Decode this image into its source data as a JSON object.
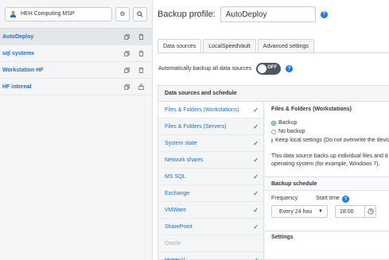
{
  "sidebar": {
    "company_name": "HEH Computing MSP",
    "profiles": [
      {
        "label": "AutoDeploy",
        "active": true
      },
      {
        "label": "sql systems",
        "active": false
      },
      {
        "label": "Workstation HF",
        "active": false
      },
      {
        "label": "HF internal",
        "active": false
      }
    ]
  },
  "header": {
    "title": "Backup profile:",
    "profile_name": "AutoDeploy"
  },
  "tabs": [
    {
      "label": "Data sources",
      "active": true
    },
    {
      "label": "LocalSpeedVault",
      "active": false
    },
    {
      "label": "Advanced settings",
      "active": false
    }
  ],
  "auto_backup": {
    "label": "Automatically backup all data sources",
    "toggle_text": "OFF"
  },
  "panel": {
    "title": "Data sources and schedule",
    "data_sources": [
      {
        "label": "Files & Folders (Workstations)",
        "checked": true,
        "disabled": false,
        "active": true
      },
      {
        "label": "Files & Folders (Servers)",
        "checked": true,
        "disabled": false,
        "active": false
      },
      {
        "label": "System state",
        "checked": true,
        "disabled": false,
        "active": false
      },
      {
        "label": "Network shares",
        "checked": true,
        "disabled": false,
        "active": false
      },
      {
        "label": "MS SQL",
        "checked": true,
        "disabled": false,
        "active": false
      },
      {
        "label": "Exchange",
        "checked": true,
        "disabled": false,
        "active": false
      },
      {
        "label": "VMWare",
        "checked": true,
        "disabled": false,
        "active": false
      },
      {
        "label": "SharePoint",
        "checked": true,
        "disabled": false,
        "active": false
      },
      {
        "label": "Oracle",
        "checked": false,
        "disabled": true,
        "active": false
      },
      {
        "label": "Hyper-V",
        "checked": true,
        "disabled": false,
        "active": false
      }
    ]
  },
  "detail": {
    "title": "Files & Folders (Workstations)",
    "options": [
      {
        "label": "Backup",
        "selected": true
      },
      {
        "label": "No backup",
        "selected": false
      },
      {
        "label": "Keep local settings (Do not overwrite the devic",
        "selected": false
      }
    ],
    "description_line1": "This data source backs up individual files and d",
    "description_line2": "operating system (for example, Windows 7).",
    "schedule_title": "Backup schedule",
    "frequency_label": "Frequency",
    "frequency_value": "Every 24 hou",
    "start_time_label": "Start time",
    "start_time_value": "18:00",
    "settings_title": "Settings"
  },
  "colors": {
    "link_blue": "#1f6fd1",
    "check_green": "#2e9f45",
    "toggle_off": "#4f5660",
    "help_blue": "#1f7be0"
  }
}
